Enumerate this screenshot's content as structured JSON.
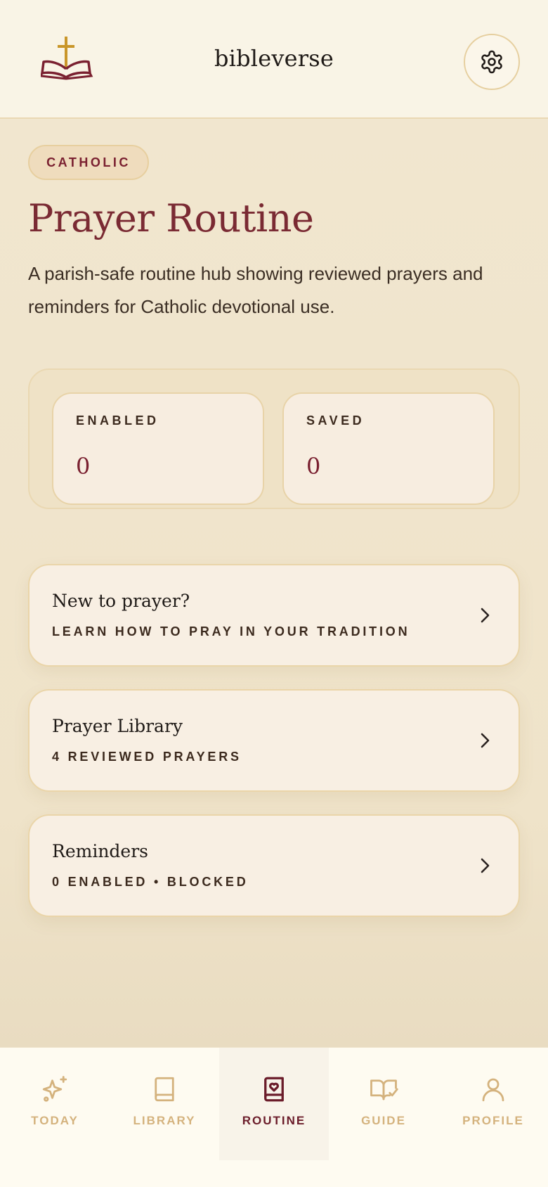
{
  "app": {
    "title": "bibleverse",
    "logo_icon": "cross-over-bible-icon",
    "settings_icon": "gear-icon"
  },
  "page": {
    "badge": "CATHOLIC",
    "title": "Prayer Routine",
    "description": "A parish-safe routine hub showing reviewed prayers and reminders for Catholic devotional use."
  },
  "stats": [
    {
      "label": "ENABLED",
      "value": "0"
    },
    {
      "label": "SAVED",
      "value": "0"
    }
  ],
  "cards": [
    {
      "title": "New to prayer?",
      "subtitle": "LEARN HOW TO PRAY IN YOUR TRADITION",
      "icon": "chevron-right-icon"
    },
    {
      "title": "Prayer Library",
      "subtitle": "4 REVIEWED PRAYERS",
      "icon": "chevron-right-icon"
    },
    {
      "title": "Reminders",
      "subtitle": "0 ENABLED • BLOCKED",
      "icon": "chevron-right-icon"
    }
  ],
  "tabs": [
    {
      "label": "TODAY",
      "icon": "sparkles-icon",
      "active": false
    },
    {
      "label": "LIBRARY",
      "icon": "book-icon",
      "active": false
    },
    {
      "label": "ROUTINE",
      "icon": "book-heart-icon",
      "active": true
    },
    {
      "label": "GUIDE",
      "icon": "open-book-check-icon",
      "active": false
    },
    {
      "label": "PROFILE",
      "icon": "user-icon",
      "active": false
    }
  ],
  "colors": {
    "accent": "#7a2a33",
    "background": "#f1e6cf",
    "gold": "#d4b27d",
    "cross": "#c9962a"
  }
}
